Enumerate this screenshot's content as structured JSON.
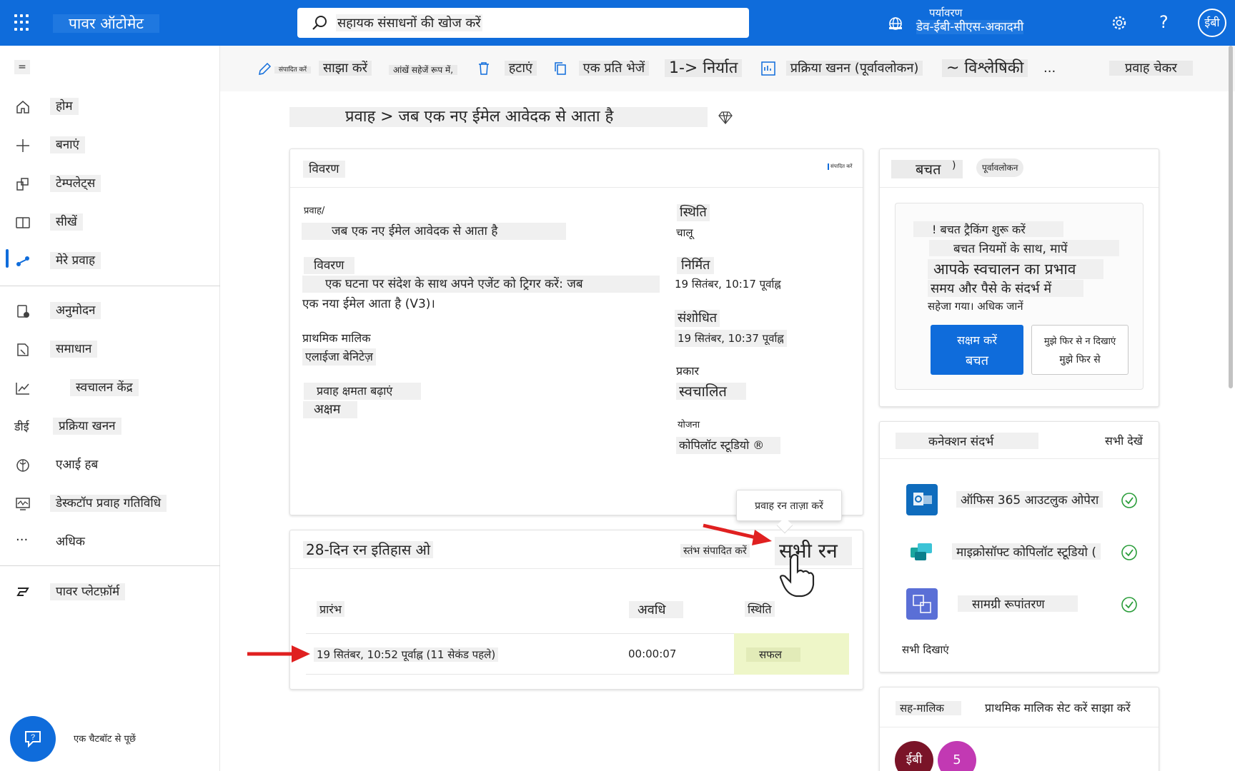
{
  "app": {
    "title": "पावर ऑटोमेट"
  },
  "search": {
    "placeholder": "सहायक संसाधनों की खोज करें"
  },
  "environment": {
    "label": "पर्यावरण",
    "name": "डेव-ईबी-सीएस-अकादमी"
  },
  "user": {
    "initials": "ईबी"
  },
  "topbar": {
    "help_label": "?"
  },
  "sidebar": {
    "collapse_label": "=",
    "items": [
      {
        "label": "होम",
        "icon": "home-icon"
      },
      {
        "label": "बनाएं",
        "icon": "plus-icon"
      },
      {
        "label": "टेम्पलेट्स",
        "icon": "templates-icon"
      },
      {
        "label": "सीखें",
        "icon": "book-icon"
      },
      {
        "label": "मेरे प्रवाह",
        "icon": "flow-icon"
      },
      {
        "label": "अनुमोदन",
        "icon": "approvals-icon"
      },
      {
        "label": "समाधान",
        "icon": "solutions-icon"
      },
      {
        "label": "स्वचालन केंद्र",
        "icon": "chart-icon"
      },
      {
        "label": "प्रक्रिया खनन",
        "icon_text": "डीई"
      },
      {
        "label": "एआई हब",
        "icon": "ai-hub-icon"
      },
      {
        "label": "डेस्कटॉप प्रवाह गतिविधि",
        "icon": "monitor-icon"
      },
      {
        "label": "अधिक",
        "icon": "more-icon",
        "icon_text": "···"
      },
      {
        "label": "पावर प्लेटफ़ॉर्म",
        "icon": "power-platform-icon"
      }
    ],
    "chatbot_label": "एक चैटबॉट से पूछें"
  },
  "commands": {
    "edit": "संपादित करें",
    "share": "साझा करें",
    "save_as": "आंखें सहेजें रूप में,",
    "delete": "हटाएं",
    "send_copy": "एक प्रति भेजें",
    "export": "1-> निर्यात",
    "process_mining": "प्रक्रिया खनन (पूर्वावलोकन)",
    "analytics": "~ विश्लेषिकी",
    "more": "...",
    "flow_checker": "प्रवाह चेकर"
  },
  "breadcrumb": "प्रवाह > जब एक नए ईमेल आवेदक से आता है",
  "details": {
    "header": "विवरण",
    "edit_link": "संपादित करें",
    "flow_label": "प्रवाह/",
    "flow_name": "जब एक नए ईमेल आवेदक से आता है",
    "desc_label": "विवरण",
    "desc_line1": "एक घटना पर संदेश के साथ अपने एजेंट को ट्रिगर करें: जब",
    "desc_line2": "एक नया ईमेल आता है (V3)।",
    "owner_label": "प्राथमिक मालिक",
    "owner_value": "एलाईजा बेनिटेज़",
    "capacity_label": "प्रवाह क्षमता बढ़ाएं",
    "capacity_value": "अक्षम",
    "status_label": "स्थिति",
    "status_value": "चालू",
    "created_label": "निर्मित",
    "created_value": "19 सितंबर, 10:17 पूर्वाह्न",
    "modified_label": "संशोधित",
    "modified_value": "19 सितंबर, 10:37 पूर्वाह्न",
    "type_label": "प्रकार",
    "type_value": "स्वचालित",
    "plan_label": "योजना",
    "plan_value": "कोपिलॉट स्टूडियो ®"
  },
  "savings": {
    "header": "बचत",
    "paren": ")",
    "badge": "पूर्वावलोकन",
    "line1": "! बचत ट्रैकिंग शुरू करें",
    "line2": "बचत नियमों के साथ, मापें",
    "line3": "आपके स्वचालन का प्रभाव",
    "line4": "समय और पैसे के संदर्भ में",
    "line5": "सहेजा गया। अधिक जानें",
    "enable_l1": "सक्षम करें",
    "enable_l2": "बचत",
    "dont_l1": "मुझे फिर से न दिखाएं",
    "dont_l2": "मुझे फिर से"
  },
  "connections": {
    "header": "कनेक्शन संदर्भ",
    "see_all": "सभी देखें",
    "items": [
      {
        "name": "ऑफिस 365 आउटलुक ओपेरा",
        "icon": "outlook-icon",
        "color": "#0f6cbd"
      },
      {
        "name": "माइक्रोसॉफ्ट कोपिलॉट स्टूडियो (",
        "icon": "copilot-studio-icon",
        "color": "#1aa6a0"
      },
      {
        "name": "सामग्री रूपांतरण",
        "icon": "content-conversion-icon",
        "color": "#5a6fd6"
      }
    ],
    "show_all": "सभी दिखाएं"
  },
  "coowners": {
    "header": "सह-मालिक",
    "actions": "प्राथमिक मालिक सेट करें साझा करें",
    "avatar1": "ईबी",
    "avatar2": "5"
  },
  "runs": {
    "header": "28-दिन रन इतिहास ओ",
    "edit_columns": "स्तंभ संपादित करें",
    "all_runs": "सभी रन",
    "tooltip": "प्रवाह रन ताज़ा करें",
    "col_start": "प्रारंभ",
    "col_duration": "अवधि",
    "col_status": "स्थिति",
    "rows": [
      {
        "start": "19 सितंबर, 10:52 पूर्वाह्न (11 सेकंड पहले)",
        "duration": "00:00:07",
        "status": "सफल"
      }
    ]
  },
  "colors": {
    "accent": "#0f6cdb",
    "success_cell": "#eef6c8",
    "arrow": "#e02020"
  }
}
